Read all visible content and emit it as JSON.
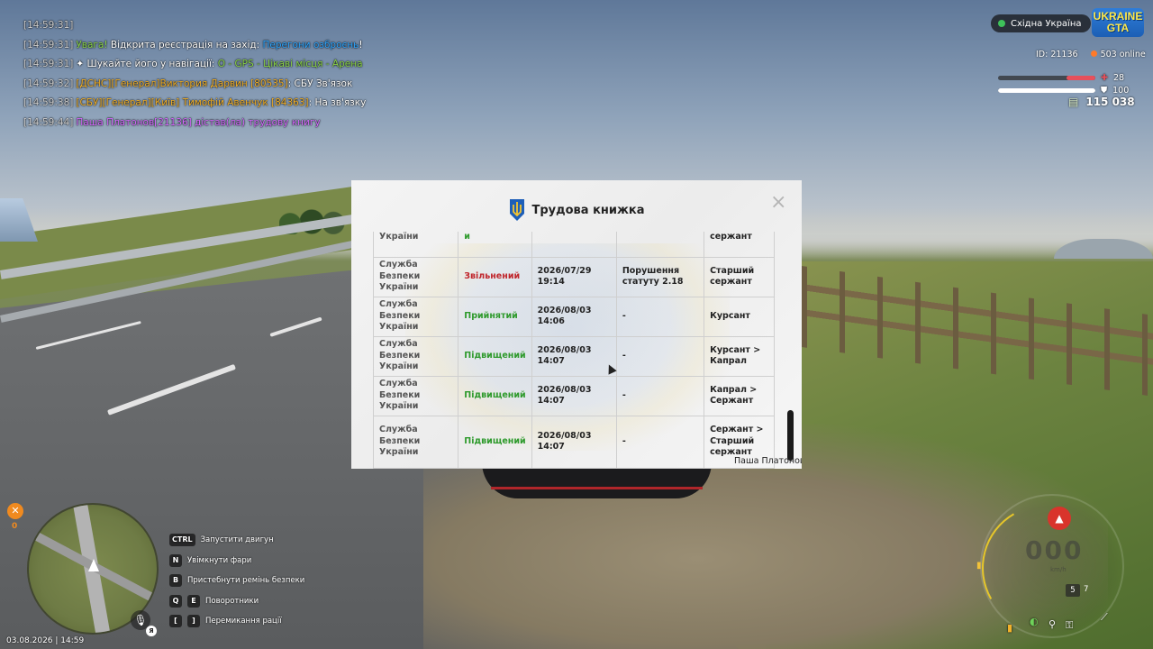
{
  "chat": [
    {
      "time": "[14:59:31]",
      "parts": []
    },
    {
      "time": "[14:59:31]",
      "parts": [
        {
          "text": "Увага!",
          "color": "green"
        },
        {
          "text": " Відкрита реєстрація на захід: ",
          "color": "white"
        },
        {
          "text": "Перегони озброєнь",
          "color": "blue"
        },
        {
          "text": "!",
          "color": "white"
        }
      ]
    },
    {
      "time": "[14:59:31]",
      "parts": [
        {
          "text": "✦ Шукайте його у навігації: ",
          "color": "white"
        },
        {
          "text": "O - GPS - Цікаві місця - Арена",
          "color": "green"
        }
      ]
    },
    {
      "time": "[14:59:32]",
      "parts": [
        {
          "text": "[ДСНС][Генерал]Виктория Дарвин [80535]",
          "color": "orange"
        },
        {
          "text": ": СБУ Зв'язок",
          "color": "white"
        }
      ]
    },
    {
      "time": "[14:59:38]",
      "parts": [
        {
          "text": "[СБУ][Генерал][Київ] Тимофій Авенчук [84363]",
          "color": "orange"
        },
        {
          "text": ": На зв'язку",
          "color": "white"
        }
      ]
    },
    {
      "time": "[14:59:44]",
      "parts": [
        {
          "text": "Паша Платонов[21136] дістав(ла) трудову книгу",
          "color": "purple"
        }
      ]
    }
  ],
  "hud": {
    "region": "Східна Україна",
    "logo_line1": "UKRAINE",
    "logo_line2": "GTA",
    "id_label": "ID: 21136",
    "online": "503 online",
    "health_value": "28",
    "health_fraction": 0.28,
    "armor_value": "100",
    "armor_fraction": 1.0,
    "money": "115 038",
    "colors": {
      "health": "#e8505b",
      "armor": "#ffffff",
      "accent_orange": "#f08a1f"
    }
  },
  "modal": {
    "title": "Трудова книжка",
    "close_icon": "×",
    "player_name": "Паша Платонов",
    "rows": [
      {
        "org": "України",
        "action": "и",
        "action_type": "ok",
        "date": "",
        "reason": "",
        "rank": "сержант"
      },
      {
        "org": "Служба Безпеки України",
        "action": "Звільнений",
        "action_type": "fired",
        "date": "2026/07/29 19:14",
        "reason": "Порушення статуту 2.18",
        "rank": "Старший сержант"
      },
      {
        "org": "Служба Безпеки України",
        "action": "Прийнятий",
        "action_type": "ok",
        "date": "2026/08/03 14:06",
        "reason": "-",
        "rank": "Курсант"
      },
      {
        "org": "Служба Безпеки України",
        "action": "Підвищений",
        "action_type": "ok",
        "date": "2026/08/03 14:07",
        "reason": "-",
        "rank": "Курсант > Капрал"
      },
      {
        "org": "Служба Безпеки України",
        "action": "Підвищений",
        "action_type": "ok",
        "date": "2026/08/03 14:07",
        "reason": "-",
        "rank": "Капрал > Сержант"
      },
      {
        "org": "Служба Безпеки України",
        "action": "Підвищений",
        "action_type": "ok",
        "date": "2026/08/03 14:07",
        "reason": "-",
        "rank": "Сержант > Старший сержант"
      }
    ]
  },
  "controls": [
    {
      "keys": [
        "CTRL"
      ],
      "label": "Запустити двигун"
    },
    {
      "keys": [
        "N"
      ],
      "label": "Увімкнути фари"
    },
    {
      "keys": [
        "B"
      ],
      "label": "Пристебнути ремінь безпеки"
    },
    {
      "keys": [
        "Q",
        "E"
      ],
      "label": "Поворотники"
    },
    {
      "keys": [
        "[",
        "]"
      ],
      "label": "Перемикання рації"
    }
  ],
  "bottom": {
    "datetime": "03.08.2026 | 14:59",
    "tools_count": "0",
    "lang": "Я"
  },
  "speedometer": {
    "speed": "000",
    "unit": "km/h",
    "gear": "5",
    "gear_next": "7"
  }
}
